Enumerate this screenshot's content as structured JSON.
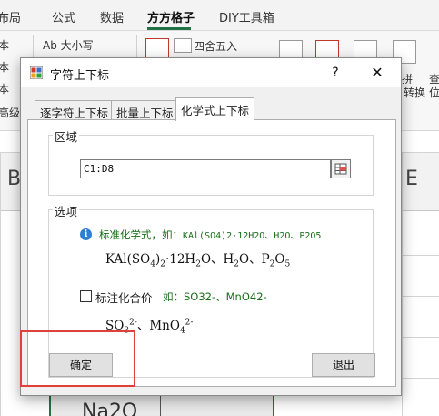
{
  "excel": {
    "tabs": [
      "布局",
      "公式",
      "数据",
      "方方格子",
      "DIY工具箱"
    ],
    "active_tab": "方方格子",
    "ribbon": {
      "left_labels": [
        "本",
        "本",
        "本",
        "高级"
      ],
      "ab_label": "Ab 大小写",
      "round_label": "四舍五入",
      "right_labels": [
        "拼",
        "转换",
        "查",
        "位"
      ]
    },
    "column_letters": [
      "B",
      "E"
    ],
    "cell_value": "Na2O"
  },
  "dialog": {
    "title": "字符上下标",
    "help": "?",
    "close": "✕",
    "tabs": [
      "逐字符上下标",
      "批量上下标",
      "化学式上下标"
    ],
    "active_tab": "化学式上下标",
    "area_group": {
      "label": "区域",
      "value": "C1:D8"
    },
    "options_group": {
      "label": "选项",
      "option1": {
        "label": "标准化学式，如：",
        "example": "KAl(SO4)2·12H2O、H2O、P2O5",
        "preview_parts": [
          "KAl(SO",
          "4",
          ")",
          "2",
          "·12H",
          "2",
          "O、H",
          "2",
          "O、P",
          "2",
          "O",
          "5"
        ]
      },
      "option2": {
        "label": "标注化合价",
        "hint": "如：SO32-、MnO42-",
        "checked": false,
        "preview_parts": [
          "SO",
          "3",
          "2-",
          "、MnO",
          "4",
          "2-"
        ]
      }
    },
    "ok_button": "确定",
    "exit_button": "退出"
  },
  "colors": {
    "excel_green": "#217346",
    "info_green": "#1a6d1a",
    "highlight_red": "#e0403a"
  }
}
